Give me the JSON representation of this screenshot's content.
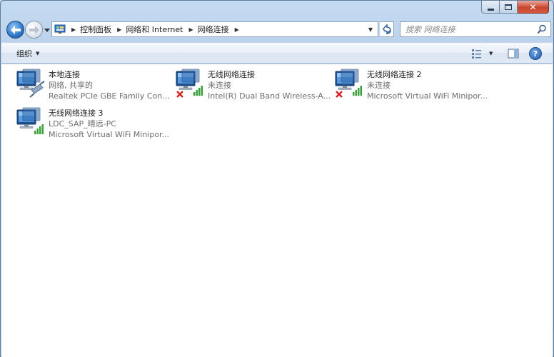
{
  "window": {
    "caption_buttons": [
      "minimize-icon",
      "maximize-icon",
      "close-icon"
    ]
  },
  "navigation": {
    "breadcrumb": [
      "控制面板",
      "网络和 Internet",
      "网络连接"
    ],
    "search_placeholder": "搜索 网络连接"
  },
  "command_bar": {
    "organize_label": "组织"
  },
  "connections": [
    {
      "name": "本地连接",
      "status": "网络, 共享的",
      "device": "Realtek PCIe GBE Family Contr...",
      "type": "ethernet",
      "disconnected": false
    },
    {
      "name": "无线网络连接",
      "status": "未连接",
      "device": "Intel(R) Dual Band Wireless-A...",
      "type": "wireless",
      "disconnected": true
    },
    {
      "name": "无线网络连接 2",
      "status": "未连接",
      "device": "Microsoft Virtual WiFi Minipor...",
      "type": "wireless",
      "disconnected": true
    },
    {
      "name": "无线网络连接 3",
      "status": "LDC_SAP_晴远-PC",
      "device": "Microsoft Virtual WiFi Minipor...",
      "type": "wireless",
      "disconnected": false
    }
  ],
  "colors": {
    "signal_bar": "#3aa03a",
    "disconnected_x": "#d42020",
    "accent": "#2f76c9"
  }
}
